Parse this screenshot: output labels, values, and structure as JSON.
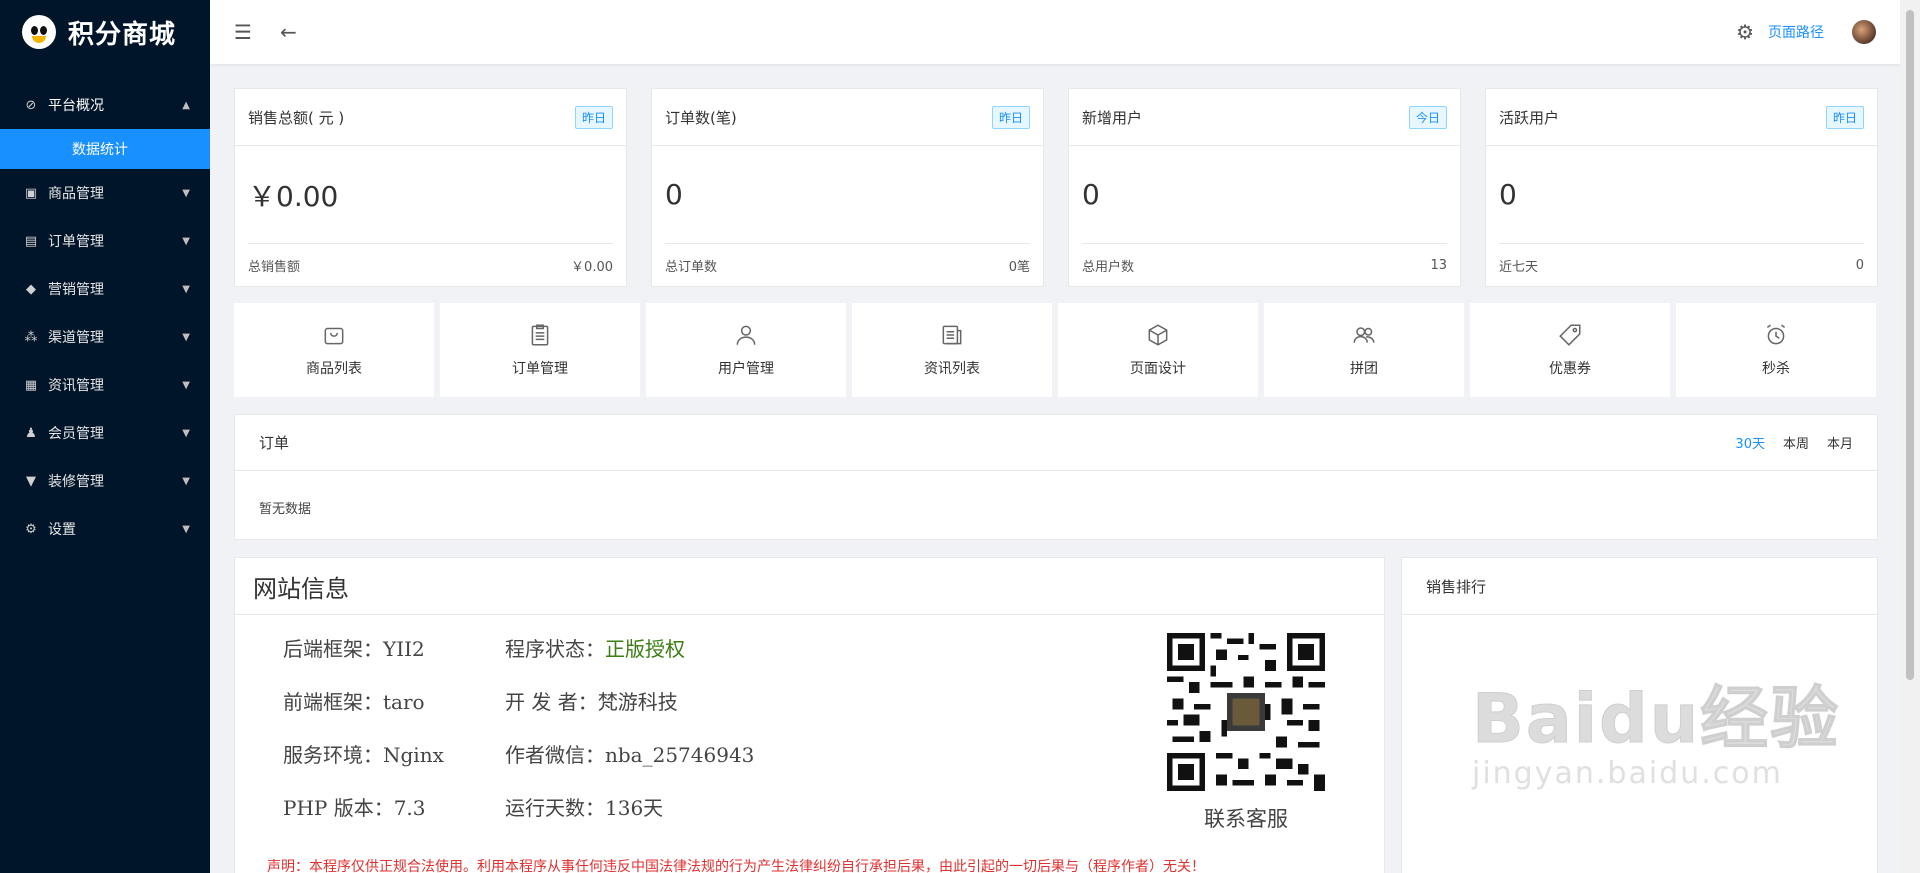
{
  "sidebar": {
    "title": "积分商城",
    "menu": [
      {
        "label": "平台概况",
        "icon": "dashboard-icon",
        "open": true
      },
      {
        "label": "商品管理",
        "icon": "goods-icon"
      },
      {
        "label": "订单管理",
        "icon": "order-icon"
      },
      {
        "label": "营销管理",
        "icon": "marketing-icon"
      },
      {
        "label": "渠道管理",
        "icon": "channel-icon"
      },
      {
        "label": "资讯管理",
        "icon": "news-icon"
      },
      {
        "label": "会员管理",
        "icon": "member-icon"
      },
      {
        "label": "装修管理",
        "icon": "decoration-icon"
      },
      {
        "label": "设置",
        "icon": "settings-icon"
      }
    ],
    "submenu_active": "数据统计"
  },
  "header": {
    "path_link": "页面路径"
  },
  "stats": [
    {
      "title": "销售总额( 元 )",
      "tag": "昨日",
      "value": "￥0.00",
      "foot_label": "总销售额",
      "foot_value": "￥0.00"
    },
    {
      "title": "订单数(笔)",
      "tag": "昨日",
      "value": "0",
      "foot_label": "总订单数",
      "foot_value": "0笔"
    },
    {
      "title": "新增用户",
      "tag": "今日",
      "value": "0",
      "foot_label": "总用户数",
      "foot_value": "13"
    },
    {
      "title": "活跃用户",
      "tag": "昨日",
      "value": "0",
      "foot_label": "近七天",
      "foot_value": "0"
    }
  ],
  "nav": [
    {
      "label": "商品列表",
      "icon": "shopping-bag-icon"
    },
    {
      "label": "订单管理",
      "icon": "clipboard-icon"
    },
    {
      "label": "用户管理",
      "icon": "user-icon"
    },
    {
      "label": "资讯列表",
      "icon": "document-icon"
    },
    {
      "label": "页面设计",
      "icon": "cube-icon"
    },
    {
      "label": "拼团",
      "icon": "group-icon"
    },
    {
      "label": "优惠券",
      "icon": "tag-icon"
    },
    {
      "label": "秒杀",
      "icon": "alarm-clock-icon"
    }
  ],
  "order": {
    "title": "订单",
    "filters": [
      "30天",
      "本周",
      "本月"
    ],
    "active_filter": "30天",
    "empty": "暂无数据"
  },
  "site": {
    "title": "网站信息",
    "col1": [
      "后端框架：YII2",
      "前端框架：taro",
      "服务环境：Nginx",
      "PHP 版本：7.3"
    ],
    "col2_status_label": "程序状态：",
    "col2_status_value": "正版授权",
    "col2": [
      "开 发 者：梵游科技",
      "作者微信：nba_25746943",
      "运行天数：136天"
    ],
    "qr_label": "联系客服",
    "disclaimer": "声明：本程序仅供正规合法使用。利用本程序从事任何违反中国法律法规的行为产生法律纠纷自行承担后果，由此引起的一切后果与（程序作者）无关！"
  },
  "rank": {
    "title": "销售排行"
  },
  "watermark": {
    "main": "Baidu经验",
    "sub": "jingyan.baidu.com"
  },
  "colors": {
    "sidebar_bg": "#001529",
    "accent": "#1890ff",
    "status_ok": "#3a7d12",
    "warning_red": "#e03030"
  }
}
